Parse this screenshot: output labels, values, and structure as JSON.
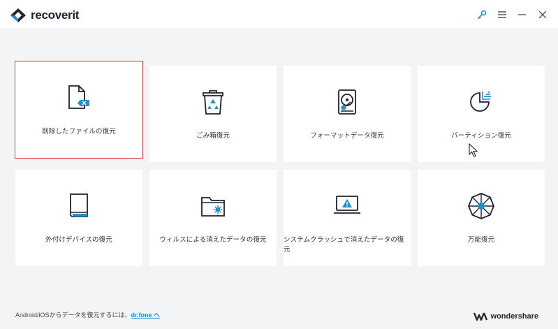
{
  "app": {
    "name": "recoverit",
    "brand_color": "#1d2233",
    "accent_color": "#1f8fcf",
    "selection_color": "#e0313a"
  },
  "window_controls": [
    {
      "name": "key-icon"
    },
    {
      "name": "menu-icon"
    },
    {
      "name": "minimize-icon"
    },
    {
      "name": "close-icon"
    }
  ],
  "modes": [
    {
      "label": "削除したファイルの復元",
      "icon": "deleted-file-icon",
      "selected": true
    },
    {
      "label": "ごみ箱復元",
      "icon": "recycle-bin-icon",
      "selected": false
    },
    {
      "label": "フォーマットデータ復元",
      "icon": "hard-drive-icon",
      "selected": false
    },
    {
      "label": "パーティション復元",
      "icon": "partition-icon",
      "selected": false
    },
    {
      "label": "外付けデバイスの復元",
      "icon": "external-device-icon",
      "selected": false
    },
    {
      "label": "ウィルスによる消えたデータの復元",
      "icon": "virus-folder-icon",
      "selected": false
    },
    {
      "label": "システムクラッシュで消えたデータの復元",
      "icon": "system-crash-icon",
      "selected": false
    },
    {
      "label": "万能復元",
      "icon": "all-around-icon",
      "selected": false
    }
  ],
  "footer": {
    "text": "Android/iOSからデータを復元するには、",
    "link": "dr.fone へ"
  },
  "brand": {
    "name": "wondershare"
  }
}
